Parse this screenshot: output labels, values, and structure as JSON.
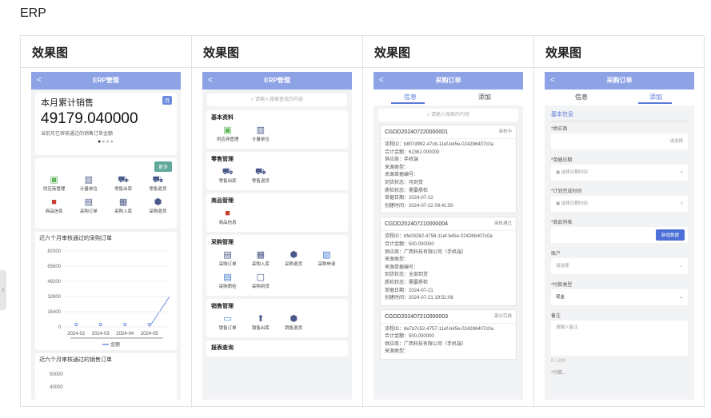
{
  "page": {
    "title": "ERP",
    "panel_label": "效果图"
  },
  "phone1": {
    "nav": "ERP管理",
    "card_title": "本月累计销售",
    "badge": "月",
    "amount": "49179.040000",
    "desc": "当前月已审核通过的销售订单金额",
    "more": "更多",
    "icons": [
      {
        "label": "供应商管理",
        "icon": "supplier-icon"
      },
      {
        "label": "计量单位",
        "icon": "unit-icon"
      },
      {
        "label": "零售出库",
        "icon": "cart-icon"
      },
      {
        "label": "零售退货",
        "icon": "cart-return-icon"
      },
      {
        "label": "商品信息",
        "icon": "goods-icon"
      },
      {
        "label": "采购订单",
        "icon": "clipboard-icon"
      },
      {
        "label": "采购入库",
        "icon": "inbound-icon"
      },
      {
        "label": "采购退货",
        "icon": "box-icon"
      }
    ],
    "chart1_title": "近六个月审核通过的采购订单",
    "chart2_title": "近六个月审核通过的销售订单",
    "legend": "金额",
    "chart2_ticks": [
      "50000",
      "40000"
    ]
  },
  "chart_data": {
    "type": "line",
    "categories": [
      "2024-02",
      "2024-03",
      "2024-04",
      "2024-05"
    ],
    "series": [
      {
        "name": "金额",
        "values": [
          0,
          0,
          0,
          0
        ]
      }
    ],
    "yticks": [
      "82000",
      "65600",
      "49200",
      "32800",
      "16400",
      "0"
    ],
    "ylim": [
      0,
      82000
    ]
  },
  "phone2": {
    "nav": "ERP管理",
    "search": "请输入搜索查找的内容",
    "sections": [
      {
        "title": "基本资料",
        "items": [
          {
            "label": "供应商管理",
            "icon": "supplier-icon"
          },
          {
            "label": "计量单位",
            "icon": "unit-icon"
          }
        ]
      },
      {
        "title": "零售管理",
        "items": [
          {
            "label": "零售出库",
            "icon": "cart-icon"
          },
          {
            "label": "零售退货",
            "icon": "cart-return-icon"
          }
        ]
      },
      {
        "title": "商品管理",
        "items": [
          {
            "label": "商品信息",
            "icon": "goods-icon"
          }
        ]
      },
      {
        "title": "采购管理",
        "items": [
          {
            "label": "采购订单",
            "icon": "clipboard-icon"
          },
          {
            "label": "采购入库",
            "icon": "inbound-icon"
          },
          {
            "label": "采购退货",
            "icon": "box-icon"
          },
          {
            "label": "采购申请",
            "icon": "request-icon"
          },
          {
            "label": "采购质检",
            "icon": "inspect-icon"
          },
          {
            "label": "采购到货",
            "icon": "truck-icon"
          }
        ]
      },
      {
        "title": "销售管理",
        "items": [
          {
            "label": "销售订单",
            "icon": "sales-order-icon"
          },
          {
            "label": "销售出库",
            "icon": "upload-icon"
          },
          {
            "label": "销售退货",
            "icon": "box-icon"
          }
        ]
      },
      {
        "title": "报表查询",
        "items": []
      }
    ]
  },
  "phone3": {
    "nav": "采购订单",
    "tabs": [
      "信息",
      "添加"
    ],
    "search": "请输入搜索的内容",
    "orders": [
      {
        "code": "CGDD202407220000001",
        "status": "审核中",
        "lines": [
          "流程ID：b807d992-47cb-11ef-b45e-024286407c0a",
          "合计金额：62362.000000",
          "供应商：手机端",
          "来源类型：",
          "来源单据编号：",
          "到货状态：待到货",
          "质检状态：需要质检",
          "单据日期：2024-07-22",
          "创建时间：2024-07-22 09:41:50"
        ]
      },
      {
        "code": "CGDD202407210000004",
        "status": "审核通过",
        "lines": [
          "流程ID：bfe03282-4758-11ef-b45e-024286407c0a",
          "合计金额：500.000000",
          "供应商：广西科技有限公司（手机端）",
          "来源类型：",
          "来源单据编号：",
          "到货状态：全部到货",
          "质检状态：需要质检",
          "单据日期：2024-07-21",
          "创建时间：2024-07-21 19:51:06"
        ]
      },
      {
        "code": "CGDD202407210000003",
        "status": "部分完成",
        "lines": [
          "流程ID：8e7d7c52-4757-11ef-b45e-024286407c0a",
          "合计金额：500.000000",
          "供应商：广西科技有限公司（手机端）",
          "来源类型："
        ]
      }
    ]
  },
  "phone4": {
    "nav": "采购订单",
    "tabs": [
      "信息",
      "添加"
    ],
    "section": "基本信息",
    "supplier_label": "*供应商",
    "supplier_ph": "请选择",
    "date_label": "*单据日期",
    "date_ph": "选择日期时间",
    "plan_label": "*计划完成时间",
    "plan_ph": "选择日期时间",
    "goods_label": "*商品列表",
    "add_btn": "新增数据",
    "account_label": "账户",
    "account_ph": "请选择",
    "pay_label": "*付款类型",
    "pay_value": "现金",
    "note_label": "备注",
    "note_ph": "请输入备注",
    "counter": "0 / 200",
    "more_label": "*付款..."
  }
}
